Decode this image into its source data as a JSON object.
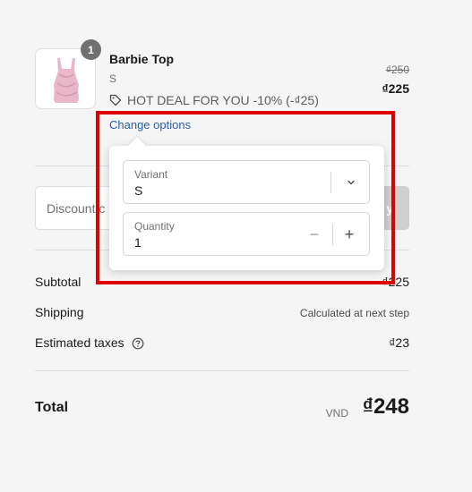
{
  "product": {
    "quantity_badge": "1",
    "name": "Barbie Top",
    "variant": "S",
    "deal_text": "HOT DEAL FOR YOU -10% (-₫25)",
    "price_original": "₫250",
    "price_current": "₫225",
    "change_options_label": "Change options"
  },
  "discount": {
    "placeholder": "Discount c",
    "apply_label": "y"
  },
  "summary": {
    "subtotal_label": "Subtotal",
    "subtotal_value": "₫225",
    "shipping_label": "Shipping",
    "shipping_value": "Calculated at next step",
    "taxes_label": "Estimated taxes",
    "taxes_value": "₫23"
  },
  "total": {
    "label": "Total",
    "currency": "VND",
    "value": "₫248"
  },
  "popover": {
    "variant_label": "Variant",
    "variant_value": "S",
    "quantity_label": "Quantity",
    "quantity_value": "1",
    "decrement_symbol": "−",
    "increment_symbol": "+"
  },
  "icons": {
    "tag": "tag-icon",
    "help": "help-circle-icon",
    "chevron": "chevron-down-icon"
  },
  "colors": {
    "link": "#2a5db0",
    "highlight": "#e00000",
    "badge": "#707070"
  }
}
